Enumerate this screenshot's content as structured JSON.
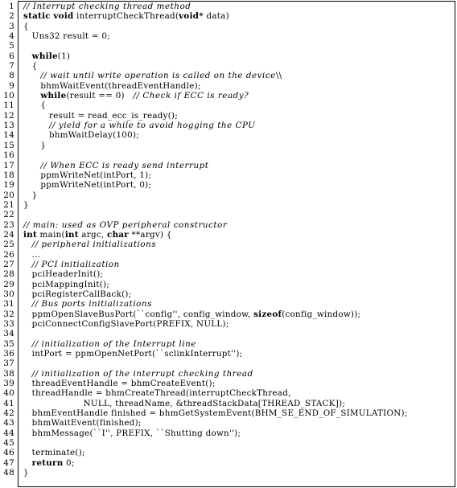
{
  "listing": {
    "language": "C",
    "first_line_number": 1,
    "total_lines": 48,
    "frame": "single-rule-box",
    "colors": {
      "background": "#ffffff",
      "text": "#000000",
      "rule": "#000000"
    },
    "lines": [
      {
        "n": "1",
        "segments": [
          {
            "style": "cmt",
            "text": "// Interrupt checking thread method"
          }
        ]
      },
      {
        "n": "2",
        "segments": [
          {
            "style": "kw",
            "text": "static"
          },
          {
            "style": "plain",
            "text": " "
          },
          {
            "style": "kw",
            "text": "void"
          },
          {
            "style": "plain",
            "text": " interruptCheckThread("
          },
          {
            "style": "kw",
            "text": "void*"
          },
          {
            "style": "plain",
            "text": " data)"
          }
        ]
      },
      {
        "n": "3",
        "segments": [
          {
            "style": "plain",
            "text": "{"
          }
        ]
      },
      {
        "n": "4",
        "segments": [
          {
            "style": "plain",
            "text": "   Uns32 result = 0;"
          }
        ]
      },
      {
        "n": "5",
        "segments": [
          {
            "style": "plain",
            "text": ""
          }
        ]
      },
      {
        "n": "6",
        "segments": [
          {
            "style": "plain",
            "text": "   "
          },
          {
            "style": "kw",
            "text": "while"
          },
          {
            "style": "plain",
            "text": "(1)"
          }
        ]
      },
      {
        "n": "7",
        "segments": [
          {
            "style": "plain",
            "text": "   {"
          }
        ]
      },
      {
        "n": "8",
        "segments": [
          {
            "style": "plain",
            "text": "      "
          },
          {
            "style": "cmt",
            "text": "// wait until write operation is called on the device"
          },
          {
            "style": "plain",
            "text": "\\\\"
          }
        ]
      },
      {
        "n": "9",
        "segments": [
          {
            "style": "plain",
            "text": "      bhmWaitEvent(threadEventHandle);"
          }
        ]
      },
      {
        "n": "10",
        "segments": [
          {
            "style": "plain",
            "text": "      "
          },
          {
            "style": "kw",
            "text": "while"
          },
          {
            "style": "plain",
            "text": "(result == 0)   "
          },
          {
            "style": "cmt",
            "text": "// Check if ECC is ready?"
          }
        ]
      },
      {
        "n": "11",
        "segments": [
          {
            "style": "plain",
            "text": "      {"
          }
        ]
      },
      {
        "n": "12",
        "segments": [
          {
            "style": "plain",
            "text": "         result = read_ecc_is_ready();"
          }
        ]
      },
      {
        "n": "13",
        "segments": [
          {
            "style": "plain",
            "text": "         "
          },
          {
            "style": "cmt",
            "text": "// yield for a while to avoid hogging the CPU"
          }
        ]
      },
      {
        "n": "14",
        "segments": [
          {
            "style": "plain",
            "text": "         bhmWaitDelay(100);"
          }
        ]
      },
      {
        "n": "15",
        "segments": [
          {
            "style": "plain",
            "text": "      }"
          }
        ]
      },
      {
        "n": "16",
        "segments": [
          {
            "style": "plain",
            "text": ""
          }
        ]
      },
      {
        "n": "17",
        "segments": [
          {
            "style": "plain",
            "text": "      "
          },
          {
            "style": "cmt",
            "text": "// When ECC is ready send interrupt"
          }
        ]
      },
      {
        "n": "18",
        "segments": [
          {
            "style": "plain",
            "text": "      ppmWriteNet(intPort, 1);"
          }
        ]
      },
      {
        "n": "19",
        "segments": [
          {
            "style": "plain",
            "text": "      ppmWriteNet(intPort, 0);"
          }
        ]
      },
      {
        "n": "20",
        "segments": [
          {
            "style": "plain",
            "text": "   }"
          }
        ]
      },
      {
        "n": "21",
        "segments": [
          {
            "style": "plain",
            "text": "}"
          }
        ]
      },
      {
        "n": "22",
        "segments": [
          {
            "style": "plain",
            "text": ""
          }
        ]
      },
      {
        "n": "23",
        "segments": [
          {
            "style": "cmt",
            "text": "// main: used as OVP peripheral constructor"
          }
        ]
      },
      {
        "n": "24",
        "segments": [
          {
            "style": "kw",
            "text": "int"
          },
          {
            "style": "plain",
            "text": " main("
          },
          {
            "style": "kw",
            "text": "int"
          },
          {
            "style": "plain",
            "text": " argc, "
          },
          {
            "style": "kw",
            "text": "char"
          },
          {
            "style": "plain",
            "text": " **argv) {"
          }
        ]
      },
      {
        "n": "25",
        "segments": [
          {
            "style": "plain",
            "text": "   "
          },
          {
            "style": "cmt",
            "text": "// peripheral initializations"
          }
        ]
      },
      {
        "n": "26",
        "segments": [
          {
            "style": "plain",
            "text": "   ..."
          }
        ]
      },
      {
        "n": "27",
        "segments": [
          {
            "style": "plain",
            "text": "   "
          },
          {
            "style": "cmt",
            "text": "// PCI initialization"
          }
        ]
      },
      {
        "n": "28",
        "segments": [
          {
            "style": "plain",
            "text": "   pciHeaderInit();"
          }
        ]
      },
      {
        "n": "29",
        "segments": [
          {
            "style": "plain",
            "text": "   pciMappingInit();"
          }
        ]
      },
      {
        "n": "30",
        "segments": [
          {
            "style": "plain",
            "text": "   pciRegisterCallBack();"
          }
        ]
      },
      {
        "n": "31",
        "segments": [
          {
            "style": "plain",
            "text": "   "
          },
          {
            "style": "cmt",
            "text": "// Bus ports initializations"
          }
        ]
      },
      {
        "n": "32",
        "segments": [
          {
            "style": "plain",
            "text": "   ppmOpenSlaveBusPort(``config'', config_window, "
          },
          {
            "style": "kw",
            "text": "sizeof"
          },
          {
            "style": "plain",
            "text": "(config_window));"
          }
        ]
      },
      {
        "n": "33",
        "segments": [
          {
            "style": "plain",
            "text": "   pciConnectConfigSlavePort(PREFIX, NULL);"
          }
        ]
      },
      {
        "n": "34",
        "segments": [
          {
            "style": "plain",
            "text": ""
          }
        ]
      },
      {
        "n": "35",
        "segments": [
          {
            "style": "plain",
            "text": "   "
          },
          {
            "style": "cmt",
            "text": "// initialization of the Interrupt line"
          }
        ]
      },
      {
        "n": "36",
        "segments": [
          {
            "style": "plain",
            "text": "   intPort = ppmOpenNetPort(``sclinkInterrupt'');"
          }
        ]
      },
      {
        "n": "37",
        "segments": [
          {
            "style": "plain",
            "text": ""
          }
        ]
      },
      {
        "n": "38",
        "segments": [
          {
            "style": "plain",
            "text": "   "
          },
          {
            "style": "cmt",
            "text": "// initialization of the interrupt checking thread"
          }
        ]
      },
      {
        "n": "39",
        "segments": [
          {
            "style": "plain",
            "text": "   threadEventHandle = bhmCreateEvent();"
          }
        ]
      },
      {
        "n": "40",
        "segments": [
          {
            "style": "plain",
            "text": "   threadHandle = bhmCreateThread(interruptCheckThread,"
          }
        ]
      },
      {
        "n": "41",
        "segments": [
          {
            "style": "plain",
            "text": "                     NULL, threadName, &threadStackData[THREAD_STACK]);"
          }
        ]
      },
      {
        "n": "42",
        "segments": [
          {
            "style": "plain",
            "text": "   bhmEventHandle finished = bhmGetSystemEvent(BHM_SE_END_OF_SIMULATION);"
          }
        ]
      },
      {
        "n": "43",
        "segments": [
          {
            "style": "plain",
            "text": "   bhmWaitEvent(finished);"
          }
        ]
      },
      {
        "n": "44",
        "segments": [
          {
            "style": "plain",
            "text": "   bhmMessage(``I'', PREFIX, ``Shutting down'');"
          }
        ]
      },
      {
        "n": "45",
        "segments": [
          {
            "style": "plain",
            "text": ""
          }
        ]
      },
      {
        "n": "46",
        "segments": [
          {
            "style": "plain",
            "text": "   terminate();"
          }
        ]
      },
      {
        "n": "47",
        "segments": [
          {
            "style": "plain",
            "text": "   "
          },
          {
            "style": "kw",
            "text": "return"
          },
          {
            "style": "plain",
            "text": " 0;"
          }
        ]
      },
      {
        "n": "48",
        "segments": [
          {
            "style": "plain",
            "text": "}"
          }
        ]
      }
    ]
  }
}
